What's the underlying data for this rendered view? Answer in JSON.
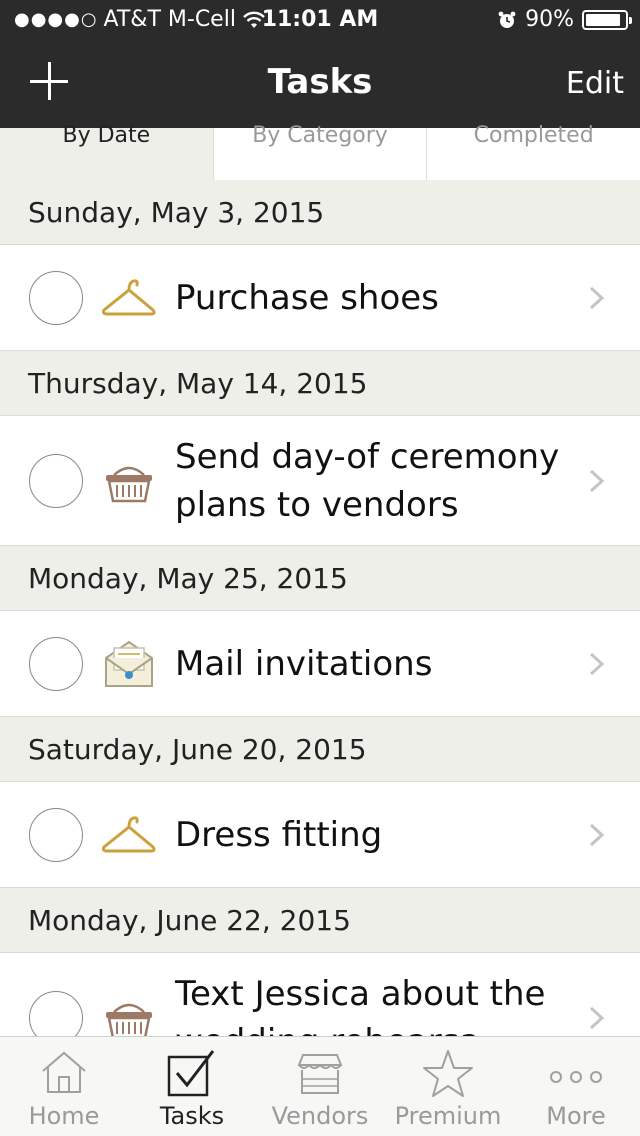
{
  "status": {
    "carrier": "AT&T M-Cell",
    "time": "11:01 AM",
    "battery": "90%",
    "battery_level": 0.9
  },
  "nav": {
    "title": "Tasks",
    "edit_label": "Edit"
  },
  "tabs": [
    "By Date",
    "By Category",
    "Completed"
  ],
  "sections": [
    {
      "date": "Sunday, May 3, 2015",
      "task": "Purchase shoes",
      "icon": "hanger-icon"
    },
    {
      "date": "Thursday, May 14, 2015",
      "task_line1": "Send day-of ceremony",
      "task_line2": "plans to vendors",
      "icon": "basket-icon"
    },
    {
      "date": "Monday, May 25, 2015",
      "task": "Mail invitations",
      "icon": "envelope-icon"
    },
    {
      "date": "Saturday, June 20, 2015",
      "task": "Dress fitting",
      "icon": "hanger-icon"
    },
    {
      "date": "Monday, June 22, 2015",
      "task_line1": "Text Jessica about the",
      "task_line2": "wedding rehearsa",
      "icon": "basket-icon"
    }
  ],
  "tabbar": {
    "items": [
      "Home",
      "Tasks",
      "Vendors",
      "Premium",
      "More"
    ],
    "active": "Tasks"
  },
  "colors": {
    "header_bg": "#2b2b2b",
    "section_bg": "#efefea",
    "hanger": "#c9a23a",
    "basket": "#9c7a66"
  }
}
